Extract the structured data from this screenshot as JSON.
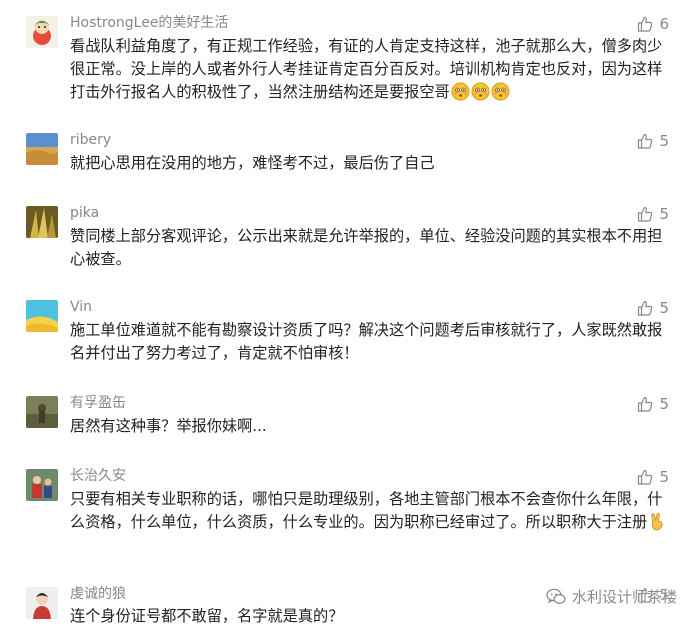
{
  "comments": [
    {
      "user": "HostrongLee的美好生活",
      "text": "看战队利益角度了，有正规工作经验，有证的人肯定支持这样，池子就那么大，僧多肉少很正常。没上岸的人或者外行人考挂证肯定百分百反对。培训机构肯定也反对，因为这样打击外行报名人的积极性了，当然注册结构还是要报空哥",
      "emoji": [
        "flushed",
        "flushed",
        "flushed"
      ],
      "likes": "6"
    },
    {
      "user": "ribery",
      "text": "就把心思用在没用的地方，难怪考不过，最后伤了自己",
      "likes": "5"
    },
    {
      "user": "pika",
      "text": "赞同楼上部分客观评论，公示出来就是允许举报的，单位、经验没问题的其实根本不用担心被查。",
      "likes": "5"
    },
    {
      "user": "Vin",
      "text": "施工单位难道就不能有勘察设计资质了吗？解决这个问题考后审核就行了，人家既然敢报名并付出了努力考过了，肯定就不怕审核！",
      "likes": "5"
    },
    {
      "user": "有孚盈缶",
      "text": "居然有这种事？举报你妹啊...",
      "likes": "5"
    },
    {
      "user": "长治久安",
      "text": "只要有相关专业职称的话，哪怕只是助理级别，各地主管部门根本不会查你什么年限，什么资格，什么单位，什么资质，什么专业的。因为职称已经审过了。所以职称大于注册",
      "emoji": [
        "victory-hand"
      ],
      "likes": "5"
    },
    {
      "user": "虔诚的狼",
      "text": "连个身份证号都不敢留，名字就是真的？",
      "likes": "5"
    }
  ],
  "watermark": {
    "text": "水利设计师茶楼",
    "icon": "wechat-icon"
  },
  "icons": {
    "like": "thumbs-up-icon"
  },
  "colors": {
    "text": "#222222",
    "meta": "#888888",
    "background": "#ffffff"
  }
}
